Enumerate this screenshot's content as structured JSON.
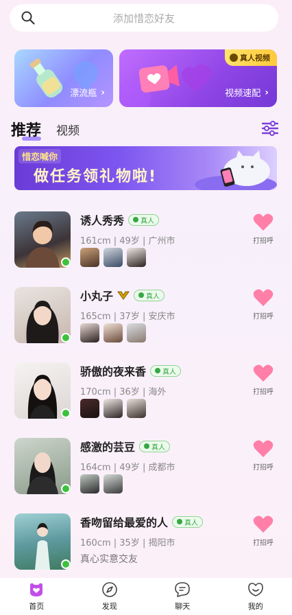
{
  "search": {
    "placeholder": "添加惜恋好友"
  },
  "cards": {
    "bottle_label": "漂流瓶",
    "video_label": "视频速配",
    "video_badge": "真人视频"
  },
  "tabs": {
    "recommend": "推荐",
    "video": "视频"
  },
  "banner": {
    "small": "惜恋喊你",
    "big": "做任务领礼物啦!"
  },
  "badge_text": "真人",
  "greet_label": "打招呼",
  "users": [
    {
      "name": "诱人秀秀",
      "info": "161cm | 49岁 | 广州市",
      "vip": false,
      "has_photos": true
    },
    {
      "name": "小丸子",
      "info": "165cm | 37岁 | 安庆市",
      "vip": true,
      "has_photos": true
    },
    {
      "name": "骄傲的夜来香",
      "info": "170cm | 36岁 | 海外",
      "vip": false,
      "has_photos": true
    },
    {
      "name": "感激的芸豆",
      "info": "164cm | 49岁 | 成都市",
      "vip": false,
      "has_photos": true
    },
    {
      "name": "香吻留给最爱的人",
      "info": "160cm | 35岁 | 揭阳市",
      "vip": false,
      "intro": "真心实意交友"
    }
  ],
  "tabbar": [
    {
      "label": "首页",
      "icon": "home-icon",
      "active": true
    },
    {
      "label": "发现",
      "icon": "compass-icon",
      "active": false
    },
    {
      "label": "聊天",
      "icon": "chat-icon",
      "active": false
    },
    {
      "label": "我的",
      "icon": "profile-icon",
      "active": false
    }
  ],
  "colors": {
    "accent": "#8a66ff",
    "online": "#3dc13d",
    "heart": "#ff6f9c"
  }
}
